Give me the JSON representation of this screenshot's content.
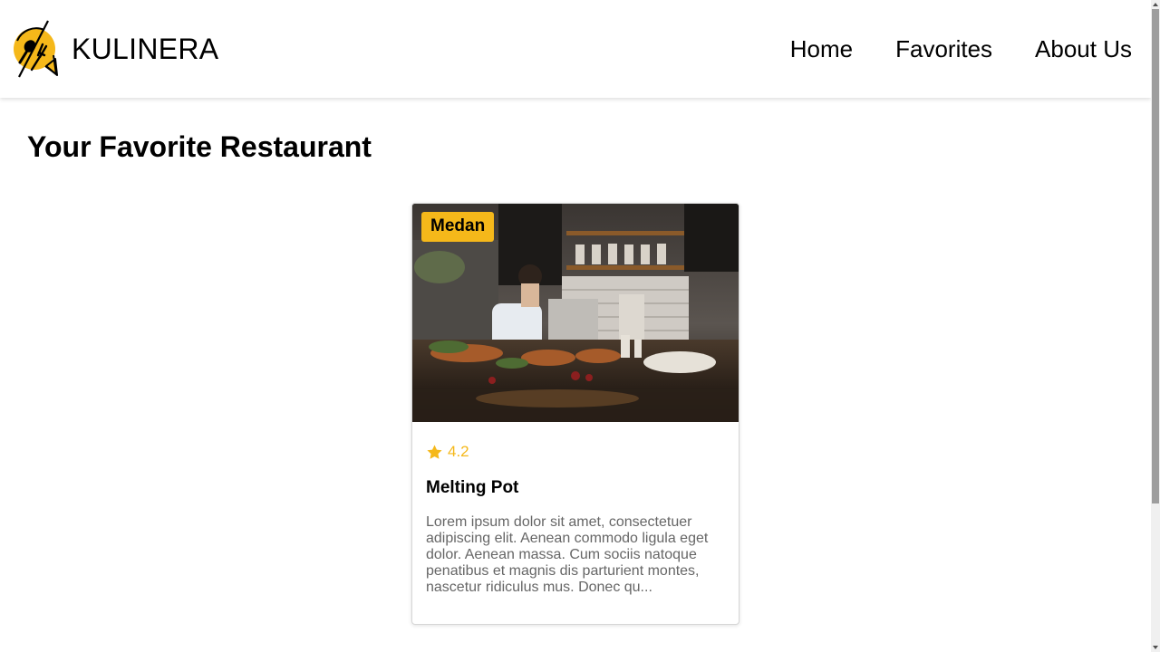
{
  "header": {
    "brand_name": "KULINERA",
    "logo_icon": "restaurant-logo-icon",
    "nav": [
      {
        "label": "Home"
      },
      {
        "label": "Favorites"
      },
      {
        "label": "About Us"
      }
    ]
  },
  "main": {
    "title": "Your Favorite Restaurant",
    "restaurants": [
      {
        "city": "Medan",
        "rating": "4.2",
        "name": "Melting Pot",
        "description": "Lorem ipsum dolor sit amet, consectetuer adipiscing elit. Aenean commodo ligula eget dolor. Aenean massa. Cum sociis natoque penatibus et magnis dis parturient montes, nascetur ridiculus mus. Donec qu..."
      }
    ]
  },
  "colors": {
    "accent": "#f5b81a",
    "text_muted": "#666666"
  }
}
